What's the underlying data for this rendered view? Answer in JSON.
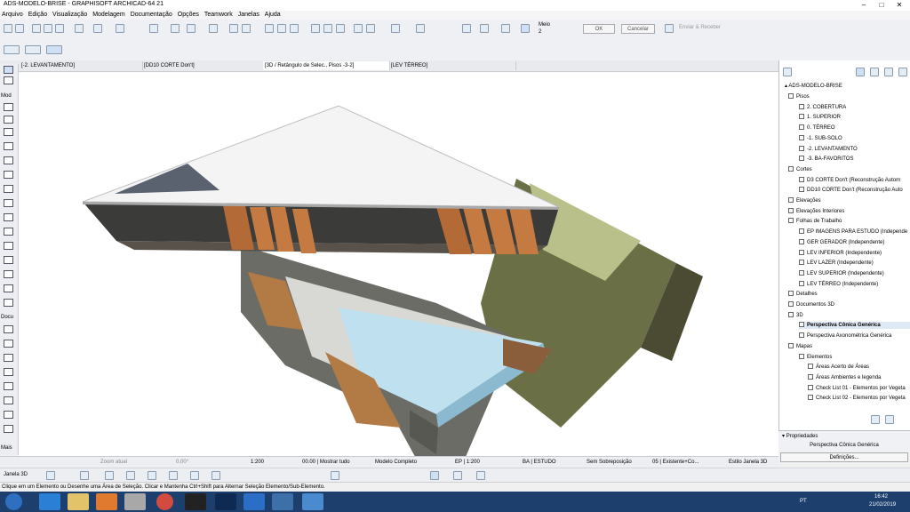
{
  "window": {
    "title": "ADS-MODELO-BRISE - GRAPHISOFT ARCHICAD-64 21"
  },
  "menu": [
    "Arquivo",
    "Edição",
    "Visualização",
    "Modelagem",
    "Documentação",
    "Opções",
    "Teamwork",
    "Janelas",
    "Ajuda"
  ],
  "toolbar": {
    "meio_label": "Meio",
    "meio_value": "2",
    "ok_label": "OK",
    "cancel_label": "Cancelar",
    "send_receive_label": "Enviar & Receber"
  },
  "tabs": [
    {
      "label": "[-2. LEVANTAMENTO]"
    },
    {
      "label": "[DD10 CORTE Don't]"
    },
    {
      "label": "[3D / Retângulo de Selec., Pisos -3-2]"
    },
    {
      "label": "[LEV TÉRREO]"
    }
  ],
  "tools": {
    "mod_label": "Mod",
    "doc_label": "Docu",
    "more_label": "Mais"
  },
  "navigator": {
    "root": "ADS-MODELO-BRISE",
    "items": [
      {
        "label": "Pisos",
        "level": 1
      },
      {
        "label": "2. COBERTURA",
        "level": 2
      },
      {
        "label": "1. SUPERIOR",
        "level": 2
      },
      {
        "label": "0. TÉRREO",
        "level": 2
      },
      {
        "label": "-1. SUB-SOLO",
        "level": 2
      },
      {
        "label": "-2. LEVANTAMENTO",
        "level": 2
      },
      {
        "label": "-3. BA-FAVORITOS",
        "level": 2
      },
      {
        "label": "Cortes",
        "level": 1
      },
      {
        "label": "D3 CORTE Don't (Reconstrução Autom",
        "level": 2
      },
      {
        "label": "DD10 CORTE Don't (Reconstrução Auto",
        "level": 2
      },
      {
        "label": "Elevações",
        "level": 1
      },
      {
        "label": "Elevações Interiores",
        "level": 1
      },
      {
        "label": "Folhas de Trabalho",
        "level": 1
      },
      {
        "label": "EP IMAGENS PARA ESTUDO (Independe",
        "level": 2
      },
      {
        "label": "GER GERADOR (Independente)",
        "level": 2
      },
      {
        "label": "LEV INFERIOR (Independente)",
        "level": 2
      },
      {
        "label": "LEV LAZER (Independente)",
        "level": 2
      },
      {
        "label": "LEV SUPERIOR (Independente)",
        "level": 2
      },
      {
        "label": "LEV TÉRREO (Independente)",
        "level": 2
      },
      {
        "label": "Detalhes",
        "level": 1
      },
      {
        "label": "Documentos 3D",
        "level": 1
      },
      {
        "label": "3D",
        "level": 1
      },
      {
        "label": "Perspectiva Cônica Genérica",
        "level": 2,
        "selected": true
      },
      {
        "label": "Perspectiva Axonométrica Genérica",
        "level": 2
      },
      {
        "label": "Mapas",
        "level": 1
      },
      {
        "label": "Elementos",
        "level": 2
      },
      {
        "label": "Áreas Acerto de Áreas",
        "level": 3
      },
      {
        "label": "Áreas Ambientes e legenda",
        "level": 3
      },
      {
        "label": "Check List 01 - Elementos por Vegeta",
        "level": 3
      },
      {
        "label": "Check List 02 - Elementos por Vegeta",
        "level": 3
      }
    ]
  },
  "properties": {
    "header": "Propriedades",
    "view_name": "Perspectiva Cônica Genérica",
    "settings_label": "Definições..."
  },
  "bottombar": {
    "zoom_label": "Zoom atual",
    "angle": "0,00°",
    "scale": "1:200",
    "layer_combo": "00.00 | Mostrar tudo",
    "model_view": "Modelo Completo",
    "pen_set": "EP | 1:200",
    "renovation": "BA | ESTUDO",
    "override": "Sem Sobreposição",
    "renovation_filter": "05 | Existente+Co...",
    "style_3d": "Estilo Janela 3D",
    "window_3d": "Janela 3D"
  },
  "status": "Clique em um Elemento ou Desenhe uma Área de Seleção. Clicar e Mantenha Ctrl+Shift para Alternar Seleção Elemento/Sub-Elemento.",
  "taskbar": {
    "lang": "PT",
    "time": "16:42",
    "date": "21/02/2019"
  },
  "colors": {
    "accent": "#1c3f6e",
    "select": "#dfe9f5"
  }
}
